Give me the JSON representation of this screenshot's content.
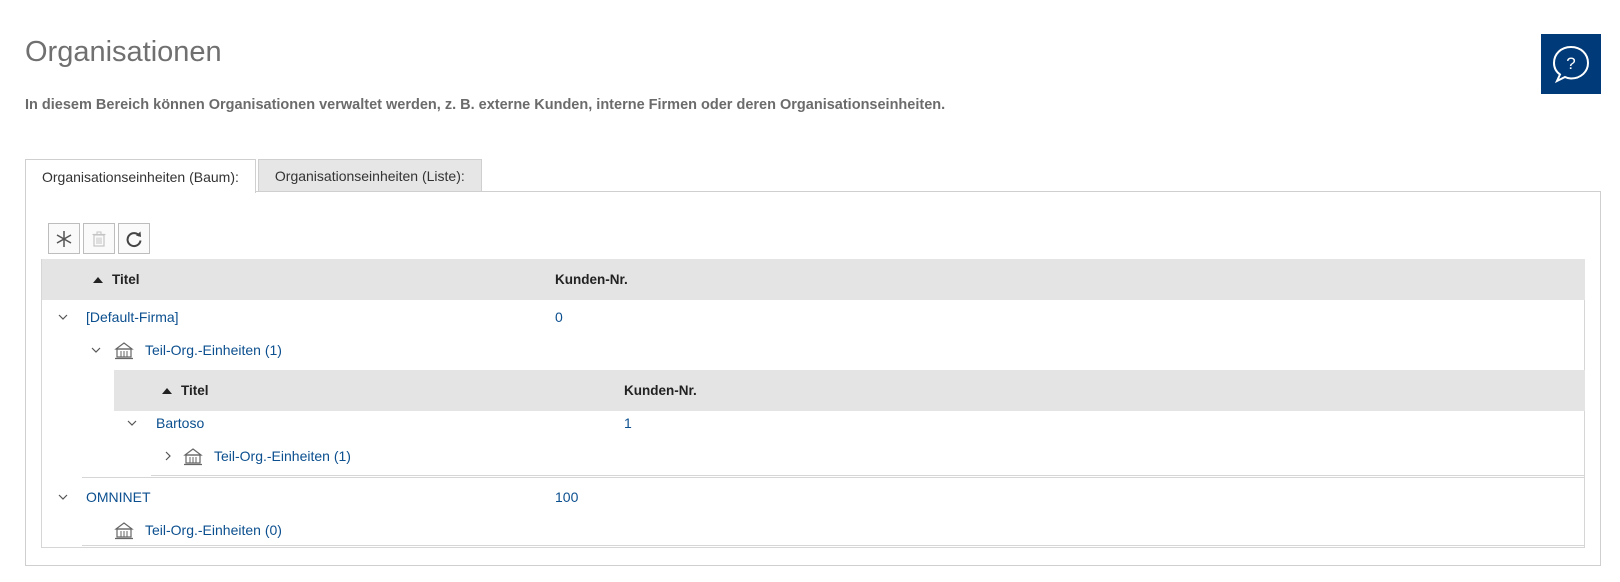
{
  "page": {
    "title": "Organisationen",
    "description": "In diesem Bereich können Organisationen verwaltet werden, z. B. externe Kunden, interne Firmen oder deren Organisationseinheiten."
  },
  "help": {
    "icon": "help-question-icon"
  },
  "tabs": [
    {
      "label": "Organisationseinheiten (Baum):",
      "active": true
    },
    {
      "label": "Organisationseinheiten (Liste):",
      "active": false
    }
  ],
  "toolbar": {
    "add_icon": "asterisk-icon",
    "delete_icon": "trash-icon",
    "refresh_icon": "refresh-icon"
  },
  "grid": {
    "columns": [
      "Titel",
      "Kunden-Nr."
    ],
    "rows": [
      {
        "title": "[Default-Firma]",
        "number": "0",
        "sub_label": "Teil-Org.-Einheiten (1)",
        "sub_grid": {
          "columns": [
            "Titel",
            "Kunden-Nr."
          ],
          "rows": [
            {
              "title": "Bartoso",
              "number": "1",
              "sub_label": "Teil-Org.-Einheiten (1)"
            }
          ]
        }
      },
      {
        "title": "OMNINET",
        "number": "100",
        "sub_label": "Teil-Org.-Einheiten (0)"
      }
    ]
  },
  "colors": {
    "accent": "#003a78",
    "link": "#0b4f8f",
    "header_bg": "#e4e4e4"
  }
}
